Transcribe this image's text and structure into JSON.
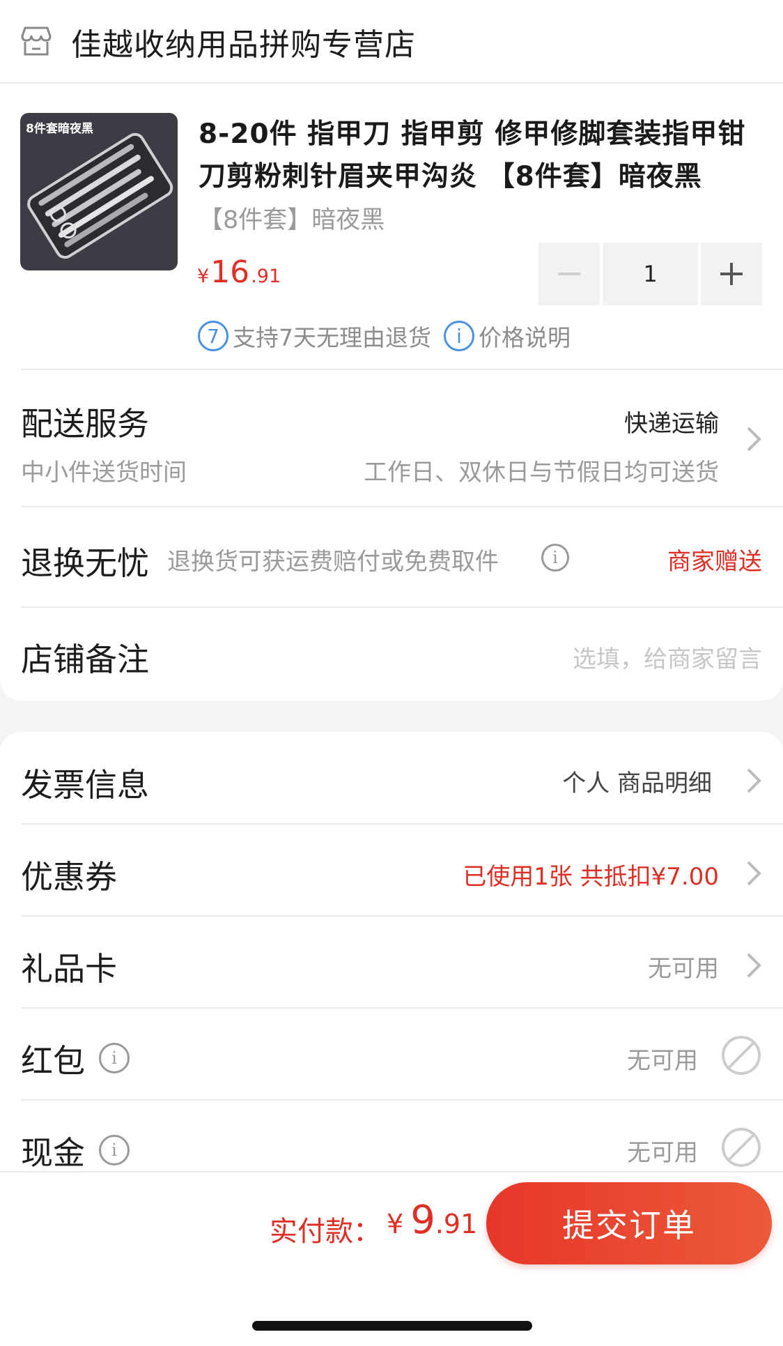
{
  "store": {
    "name": "佳越收纳用品拼购专营店"
  },
  "product": {
    "thumb_label": "8件套暗夜黑",
    "title": "8-20件 指甲刀 指甲剪 修甲修脚套装指甲钳刀剪粉刺针眉夹甲沟炎 【8件套】暗夜黑",
    "variant": "【8件套】暗夜黑",
    "price_currency": "¥",
    "price_int": "16",
    "price_dec": ".91",
    "quantity": "1",
    "promo_badge": "7",
    "promo_return": "支持7天无理由退货",
    "promo_info_badge": "i",
    "promo_price_note": "价格说明"
  },
  "delivery": {
    "title": "配送服务",
    "subtitle": "中小件送货时间",
    "method": "快递运输",
    "schedule": "工作日、双休日与节假日均可送货"
  },
  "returns": {
    "title": "退换无忧",
    "desc": "退换货可获运费赔付或免费取件",
    "info_badge": "i",
    "tag": "商家赠送"
  },
  "note": {
    "title": "店铺备注",
    "placeholder": "选填，给商家留言"
  },
  "invoice": {
    "title": "发票信息",
    "value": "个人 商品明细"
  },
  "coupon": {
    "title": "优惠券",
    "value": "已使用1张 共抵扣¥7.00"
  },
  "giftcard": {
    "title": "礼品卡",
    "value": "无可用"
  },
  "redpacket": {
    "title": "红包",
    "info_badge": "i",
    "value": "无可用"
  },
  "cash": {
    "title": "现金",
    "info_badge": "i",
    "value": "无可用"
  },
  "footer": {
    "pay_label": "实付款：",
    "pay_currency": "¥",
    "pay_int": "9",
    "pay_dec": ".91",
    "submit_label": "提交订单"
  },
  "colors": {
    "accent": "#e02e24",
    "info_blue": "#4a90e2"
  }
}
